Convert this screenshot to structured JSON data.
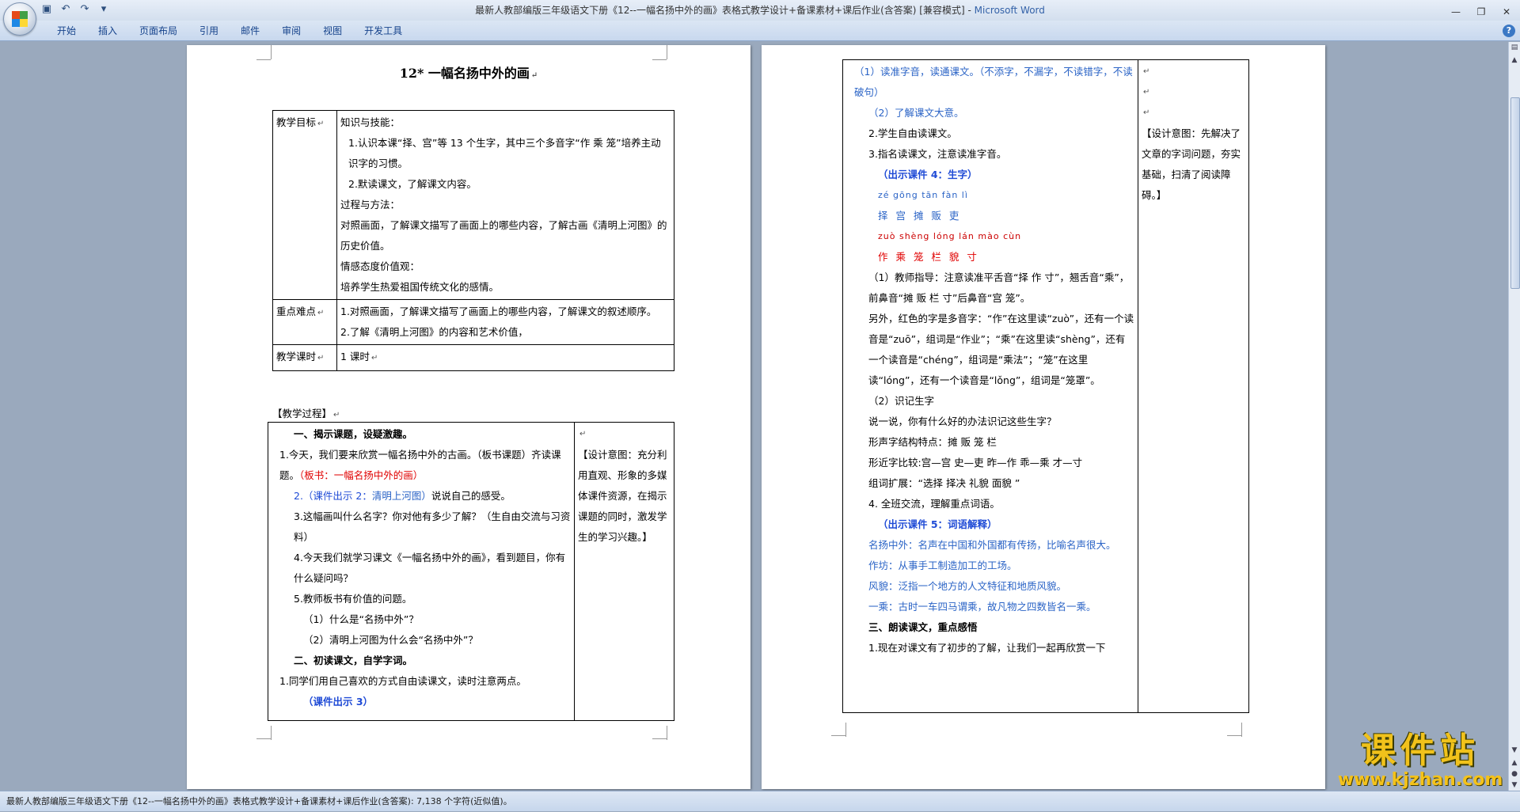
{
  "window": {
    "title": "最新人教部编版三年级语文下册《12--一幅名扬中外的画》表格式教学设计+备课素材+课后作业(含答案) [兼容模式] - ",
    "app": "Microsoft Word"
  },
  "qat": [
    "save-icon",
    "undo-icon",
    "redo-icon",
    "customize-icon"
  ],
  "ribbon_tabs": [
    "开始",
    "插入",
    "页面布局",
    "引用",
    "邮件",
    "审阅",
    "视图",
    "开发工具"
  ],
  "page1": {
    "title": "12* 一幅名扬中外的画",
    "goals_label": "教学目标",
    "goals": [
      "知识与技能：",
      "1.认识本课“择、宫”等 13 个生字，其中三个多音字“作 乘 笼”培养主动识字的习惯。",
      "2.默读课文，了解课文内容。",
      "过程与方法：",
      "对照画面，了解课文描写了画面上的哪些内容，了解古画《清明上河图》的历史价值。",
      "情感态度价值观：",
      "培养学生热爱祖国传统文化的感情。"
    ],
    "key_label": "重点难点",
    "key": [
      "1.对照画面，了解课文描写了画面上的哪些内容，了解课文的叙述顺序。",
      "2.了解《清明上河图》的内容和艺术价值，"
    ],
    "hours_label": "教学课时",
    "hours": "1 课时",
    "process_label": "【教学过程】",
    "step1": "一、揭示课题，设疑激趣。",
    "p1a": "1.今天，我们要来欣赏一幅名扬中外的古画。（板书课题）齐读课题。",
    "p1a_red": "（板书：一幅名扬中外的画）",
    "p2_blue": "2.（课件出示 2：",
    "p2_link": "清明上河图）",
    "p2_rest": "说说自己的感受。",
    "p3": "3.这幅画叫什么名字？你对他有多少了解？（生自由交流与习资料）",
    "p4": "4.今天我们就学习课文《一幅名扬中外的画》，看到题目，你有什么疑问吗？",
    "p5": "5.教师板书有价值的问题。",
    "p5a": "（1）什么是“名扬中外”？",
    "p5b": "（2）清明上河图为什么会“名扬中外”？",
    "step2": "二、初读课文，自学字词。",
    "p6": "1.同学们用自己喜欢的方式自由读课文，读时注意两点。",
    "p6_blue": "（课件出示 3）",
    "design1": "【设计意图：充分利用直观、形象的多媒体课件资源，在揭示课题的同时，激发学生的学习兴趣。】"
  },
  "page2": {
    "r1": "（1）读准字音，读通课文。（不添字，不漏字，不读错字，不读破句）",
    "r2": "（2）了解课文大意。",
    "r3": "2.学生自由读课文。",
    "r4": "3.指名读课文，注意读准字音。",
    "r5": "（出示课件 4：生字）",
    "pin1": "zé  gōng  tān  fàn  lì",
    "chars1": "择 宫  摊  贩  吏",
    "pin2": "zuò shèng lóng lán mào cùn",
    "chars2": "作  乘   笼  栏  貌  寸",
    "r6": "（1）教师指导：注意读准平舌音“择 作 寸”，翘舌音“乘”，前鼻音“摊 贩 栏 寸”后鼻音“宫 笼”。",
    "r7": "另外，红色的字是多音字：“作”在这里读“zuò”，还有一个读音是“zuō”，组词是“作业”；“乘”在这里读“shèng”，还有一个读音是“chéng”，组词是“乘法”；“笼”在这里读“lóng”，还有一个读音是“lǒng”，组词是“笼罩”。",
    "r8": "（2）识记生字",
    "r9": "说一说，你有什么好的办法识记这些生字？",
    "r10": "形声字结构特点：摊 贩 笼 栏",
    "r11": "形近字比较:宫—宫  史—吏  昨—作  乖—乘  才—寸",
    "r12": "组词扩展：“选择  择决  礼貌  面貌 ”",
    "r13": "4. 全班交流，理解重点词语。",
    "r14": "（出示课件 5：词语解释）",
    "r15": "名扬中外：名声在中国和外国都有传扬，比喻名声很大。",
    "r16": "作坊：从事手工制造加工的工场。",
    "r17": "风貌：泛指一个地方的人文特征和地质风貌。",
    "r18": "一乘：古时一车四马谓乘，故凡物之四数皆名一乘。",
    "r19": "三、朗读课文，重点感悟",
    "r20": "1.现在对课文有了初步的了解，让我们一起再欣赏一下",
    "design2": "【设计意图：先解决了文章的字词问题，夯实基础，扫清了阅读障碍。】"
  },
  "status": "最新人教部编版三年级语文下册《12--一幅名扬中外的画》表格式教学设计+备课素材+课后作业(含答案): 7,138 个字符(近似值)。",
  "watermark": {
    "main": "课件站",
    "url": "www.kjzhan.com"
  }
}
